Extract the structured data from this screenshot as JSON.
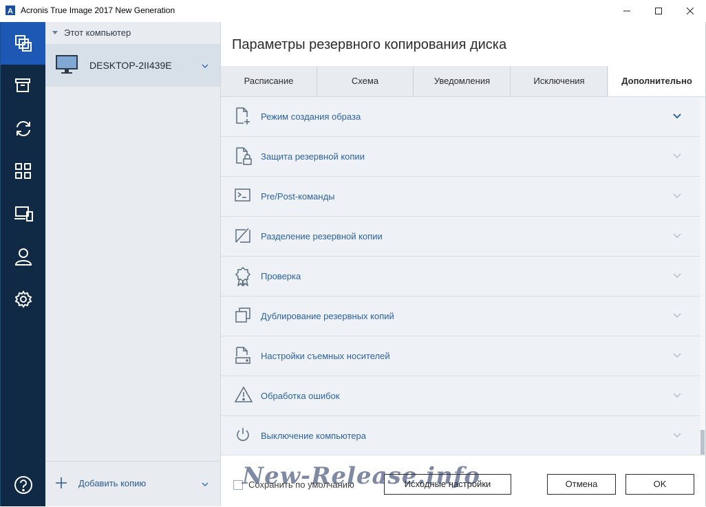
{
  "window": {
    "title": "Acronis True Image 2017 New Generation",
    "app_logo_letter": "A"
  },
  "nav": {
    "items": [
      {
        "icon": "backup-copies-icon",
        "active": true
      },
      {
        "icon": "archive-icon",
        "active": false
      },
      {
        "icon": "sync-icon",
        "active": false
      },
      {
        "icon": "tools-grid-icon",
        "active": false
      },
      {
        "icon": "devices-icon",
        "active": false
      },
      {
        "icon": "account-icon",
        "active": false
      },
      {
        "icon": "settings-icon",
        "active": false
      }
    ],
    "help_icon": "help-icon"
  },
  "sidebar": {
    "header": "Этот компьютер",
    "item_label": "DESKTOP-2II439E",
    "add_label": "Добавить копию"
  },
  "main": {
    "title": "Параметры резервного копирования диска",
    "tabs": [
      "Расписание",
      "Схема",
      "Уведомления",
      "Исключения",
      "Дополнительно"
    ],
    "active_tab": "Дополнительно",
    "rows": [
      {
        "label": "Режим создания образа",
        "icon": "file-add-icon",
        "expanded_hint": true
      },
      {
        "label": "Защита резервной копии",
        "icon": "file-lock-icon",
        "expanded_hint": false
      },
      {
        "label": "Pre/Post-команды",
        "icon": "terminal-icon",
        "expanded_hint": false
      },
      {
        "label": "Разделение резервной копии",
        "icon": "split-icon",
        "expanded_hint": false
      },
      {
        "label": "Проверка",
        "icon": "badge-icon",
        "expanded_hint": false
      },
      {
        "label": "Дублирование резервных копий",
        "icon": "duplicate-icon",
        "expanded_hint": false
      },
      {
        "label": "Настройки съемных носителей",
        "icon": "removable-drive-icon",
        "expanded_hint": false
      },
      {
        "label": "Обработка ошибок",
        "icon": "warning-icon",
        "expanded_hint": false
      },
      {
        "label": "Выключение компьютера",
        "icon": "power-icon",
        "expanded_hint": false
      }
    ]
  },
  "footer": {
    "save_default_label": "Сохранить по умолчанию",
    "reset_label": "Исходные настройки",
    "cancel_label": "Отмена",
    "ok_label": "OK"
  },
  "watermark": "New-Release.info",
  "colors": {
    "nav_bg": "#102a46",
    "nav_active": "#1c58b4",
    "accent_text": "#2d62a3"
  }
}
